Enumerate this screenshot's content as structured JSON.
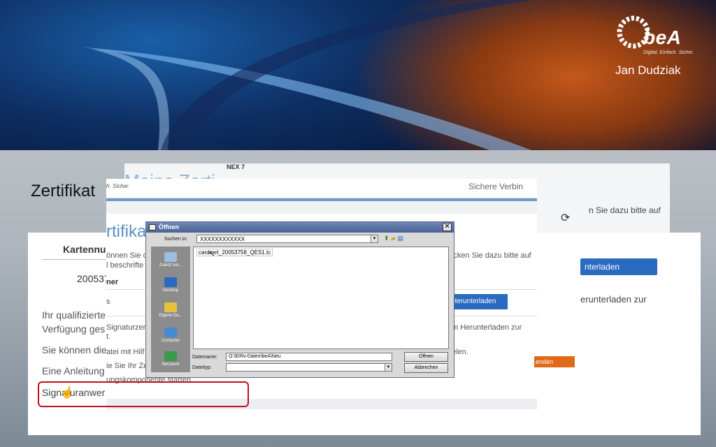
{
  "banner": {
    "logo_text": "beA",
    "logo_tagline": "Digital. Einfach. Sicher.",
    "presenter": "Jan Dudziak"
  },
  "slide_title": "Zertifikat",
  "back_shot": {
    "title": "Meine Zerti",
    "nex_label": "NEX 7",
    "side_hint": "n Sie dazu bitte auf"
  },
  "left_shot": {
    "table_header": "Kartennu",
    "number": "200537",
    "lines": [
      "Ihr qualifizierte",
      "Verfügung ges",
      "Sie können die",
      "Eine Anleitung",
      "Signaturanwer"
    ],
    "right_button": "nterladen",
    "right_text": "erunterladen zur"
  },
  "mid_shot": {
    "crumb": "h. Sicher.",
    "secure_label": "Sichere Verbin",
    "heading": "rtifikat",
    "intro_1": "önnen Sie d",
    "intro_2": "l beschrifte",
    "intro_right": "icken Sie dazu bitte auf",
    "subhead": "ner",
    "col_left": "s",
    "download_button": "Herunterladen",
    "sig_1": "Signaturzer",
    "sig_2": "t.",
    "sig_right": "m Herunterladen zur",
    "datei": "atei mit Hilf",
    "datei_right": "elen.",
    "ie": "ie Sie Ihr Ze",
    "komp": "ungskomponente starten",
    "orange_button": "enden"
  },
  "dialog": {
    "title": "Öffnen",
    "close": "✕",
    "look_in_label": "Suchen in:",
    "look_in_value": "XXXXXXXXXXXX",
    "places": [
      "Zuletzt ver...",
      "Desktop",
      "Eigene Da...",
      "Computer",
      "Netzwerk"
    ],
    "file": "cardcert_20053758_QES1.tc",
    "filename_label": "Dateiname:",
    "filename_value": "O:\\EIRv-Daten\\beA\\Neu",
    "filetype_label": "Dateityp:",
    "filetype_value": "",
    "open_button": "Öffnen",
    "cancel_button": "Abbrechen"
  },
  "icons": {
    "refresh": "refresh-icon",
    "cursor": "hand-cursor-icon"
  }
}
